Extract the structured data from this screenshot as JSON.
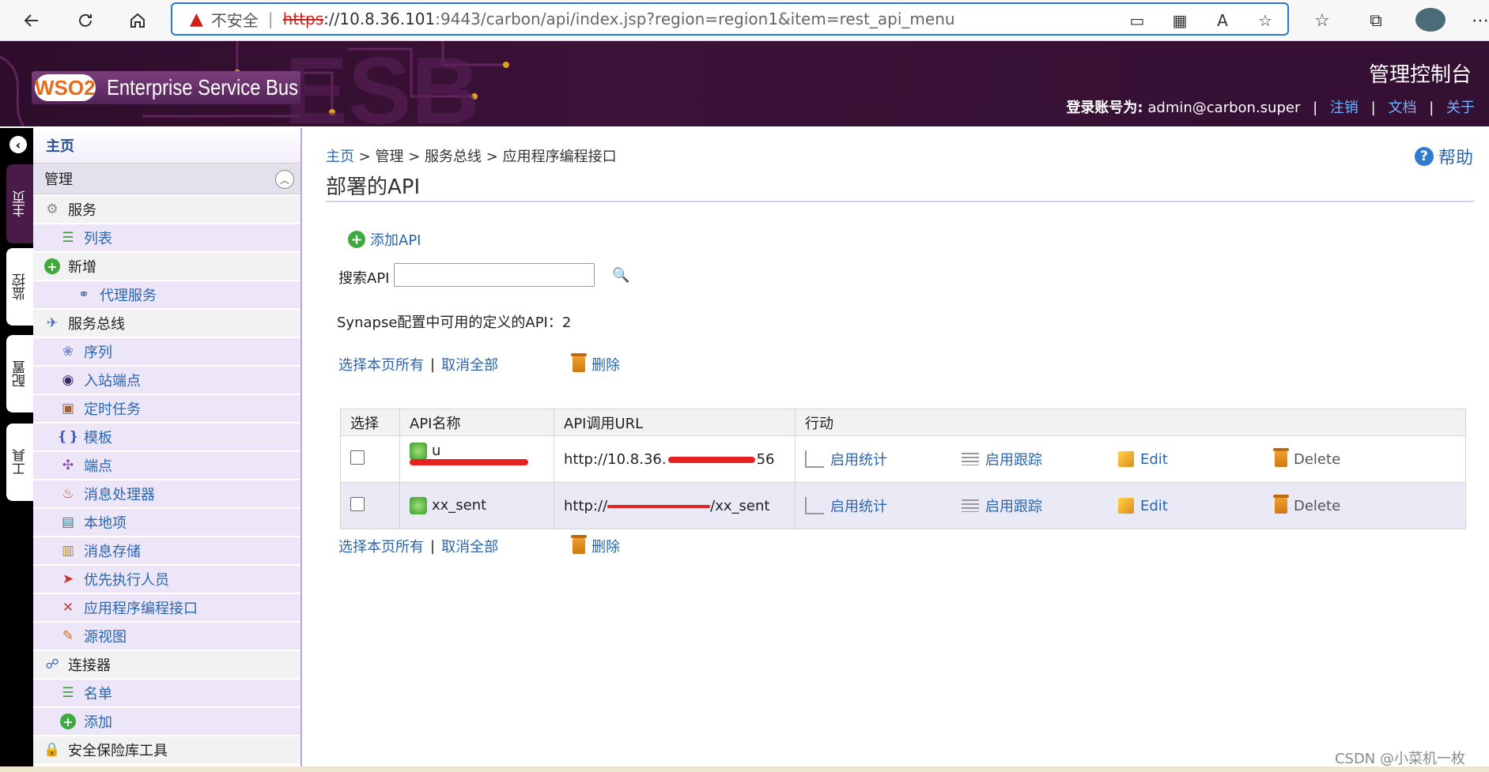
{
  "browser": {
    "insecure_label": "不安全",
    "url_proto": "https",
    "url_host": "://10.8.36.101",
    "url_rest": ":9443/carbon/api/index.jsp?region=region1&item=rest_api_menu"
  },
  "header": {
    "logo_brand": "WSO2",
    "logo_product": "Enterprise Service Bus",
    "console_title": "管理控制台",
    "login_label": "登录账号为:",
    "login_user": "admin@carbon.super",
    "logout": "注销",
    "docs": "文档",
    "about": "关于"
  },
  "left_tabs": [
    "主页",
    "监控",
    "配置",
    "工具"
  ],
  "menu": {
    "home": "主页",
    "manage": "管理",
    "items": [
      {
        "label": "服务",
        "type": "cat",
        "icon": "gear-icon"
      },
      {
        "label": "列表",
        "type": "sub",
        "icon": "list-icon"
      },
      {
        "label": "新增",
        "type": "cat",
        "icon": "add-icon"
      },
      {
        "label": "代理服务",
        "type": "sub2",
        "icon": "proxy-icon"
      },
      {
        "label": "服务总线",
        "type": "cat",
        "icon": "bus-icon"
      },
      {
        "label": "序列",
        "type": "sub",
        "icon": "sequence-icon"
      },
      {
        "label": "入站端点",
        "type": "sub",
        "icon": "inbound-icon"
      },
      {
        "label": "定时任务",
        "type": "sub",
        "icon": "task-icon"
      },
      {
        "label": "模板",
        "type": "sub",
        "icon": "template-icon"
      },
      {
        "label": "端点",
        "type": "sub",
        "icon": "endpoint-icon"
      },
      {
        "label": "消息处理器",
        "type": "sub",
        "icon": "processor-icon"
      },
      {
        "label": "本地项",
        "type": "sub",
        "icon": "local-entry-icon"
      },
      {
        "label": "消息存储",
        "type": "sub",
        "icon": "store-icon"
      },
      {
        "label": "优先执行人员",
        "type": "sub",
        "icon": "priority-icon"
      },
      {
        "label": "应用程序编程接口",
        "type": "sub",
        "icon": "api-icon"
      },
      {
        "label": "源视图",
        "type": "sub",
        "icon": "source-icon"
      },
      {
        "label": "连接器",
        "type": "cat",
        "icon": "connector-icon"
      },
      {
        "label": "名单",
        "type": "sub",
        "icon": "list-icon"
      },
      {
        "label": "添加",
        "type": "sub",
        "icon": "add-icon"
      },
      {
        "label": "安全保险库工具",
        "type": "cat",
        "icon": "vault-icon"
      }
    ]
  },
  "content": {
    "breadcrumb": {
      "home": "主页",
      "sep": " > ",
      "manage": "管理",
      "bus": "服务总线",
      "api": "应用程序编程接口"
    },
    "help": "帮助",
    "title": "部署的API",
    "add_api": "添加API",
    "search_label": "搜索API",
    "search_value": "",
    "api_count_text": "Synapse配置中可用的定义的API：2",
    "select_all": "选择本页所有",
    "deselect_all": "取消全部",
    "delete": "删除",
    "table": {
      "headers": [
        "选择",
        "API名称",
        "API调用URL",
        "行动"
      ],
      "rows": [
        {
          "name": "u",
          "url": "http://10.8.36.",
          "url_tail": "56"
        },
        {
          "name": "xx_sent",
          "url": "http://",
          "url_tail": "/xx_sent"
        }
      ],
      "actions": {
        "stats": "启用统计",
        "trace": "启用跟踪",
        "edit": "Edit",
        "delete": "Delete"
      }
    }
  },
  "watermark": "CSDN @小菜机一枚"
}
